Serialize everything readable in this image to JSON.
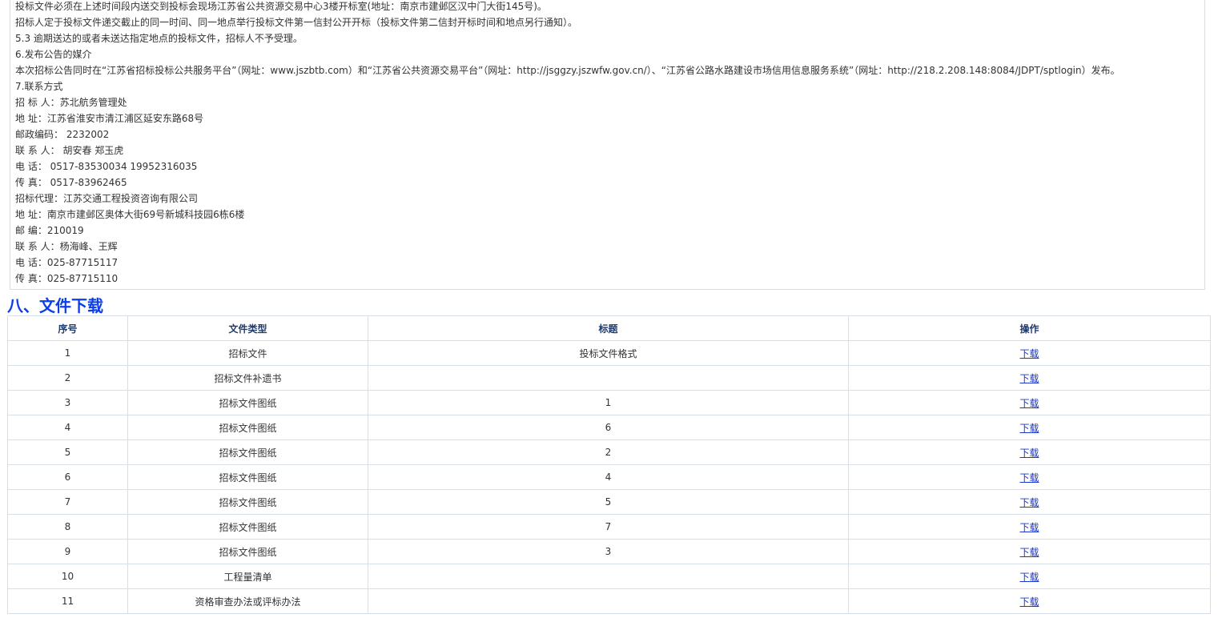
{
  "notice": {
    "lines": [
      "投标文件必须在上述时间段内送交到投标会现场江苏省公共资源交易中心3楼开标室(地址：南京市建邺区汉中门大街145号)。",
      "招标人定于投标文件递交截止的同一时间、同一地点举行投标文件第一信封公开开标（投标文件第二信封开标时间和地点另行通知）。",
      "5.3 逾期送达的或者未送达指定地点的投标文件，招标人不予受理。",
      "6.发布公告的媒介",
      "本次招标公告同时在“江苏省招标投标公共服务平台”（网址：www.jszbtb.com）和“江苏省公共资源交易平台”（网址：http://jsggzy.jszwfw.gov.cn/）、“江苏省公路水路建设市场信用信息服务系统”（网址：http://218.2.208.148:8084/JDPT/sptlogin）发布。",
      "7.联系方式",
      "招 标 人：苏北航务管理处",
      "地 址：江苏省淮安市清江浦区延安东路68号",
      "邮政编码： 2232002",
      "联 系 人： 胡安春 郑玉虎",
      "电 话： 0517-83530034 19952316035",
      "传 真： 0517-83962465",
      "招标代理：江苏交通工程投资咨询有限公司",
      "地 址：南京市建邺区奥体大街69号新城科技园6栋6楼",
      "邮 编：210019",
      "联 系 人：杨海峰、王辉",
      "电 话：025-87715117",
      "传 真：025-87715110"
    ]
  },
  "section": {
    "title": "八、文件下载"
  },
  "table": {
    "headers": {
      "index": "序号",
      "type": "文件类型",
      "title": "标题",
      "action": "操作"
    },
    "rows": [
      {
        "index": "1",
        "type": "招标文件",
        "title": "投标文件格式",
        "action": "下载"
      },
      {
        "index": "2",
        "type": "招标文件补遗书",
        "title": "",
        "action": "下载"
      },
      {
        "index": "3",
        "type": "招标文件图纸",
        "title": "1",
        "action": "下载"
      },
      {
        "index": "4",
        "type": "招标文件图纸",
        "title": "6",
        "action": "下载"
      },
      {
        "index": "5",
        "type": "招标文件图纸",
        "title": "2",
        "action": "下载"
      },
      {
        "index": "6",
        "type": "招标文件图纸",
        "title": "4",
        "action": "下载"
      },
      {
        "index": "7",
        "type": "招标文件图纸",
        "title": "5",
        "action": "下载"
      },
      {
        "index": "8",
        "type": "招标文件图纸",
        "title": "7",
        "action": "下载"
      },
      {
        "index": "9",
        "type": "招标文件图纸",
        "title": "3",
        "action": "下载"
      },
      {
        "index": "10",
        "type": "工程量清单",
        "title": "",
        "action": "下载"
      },
      {
        "index": "11",
        "type": "资格审查办法或评标办法",
        "title": "",
        "action": "下载"
      }
    ]
  },
  "colors": {
    "section_title": "#0b3ee8",
    "link": "#1a37c8",
    "header_text": "#1f3c6e",
    "border": "#d6dfea"
  }
}
